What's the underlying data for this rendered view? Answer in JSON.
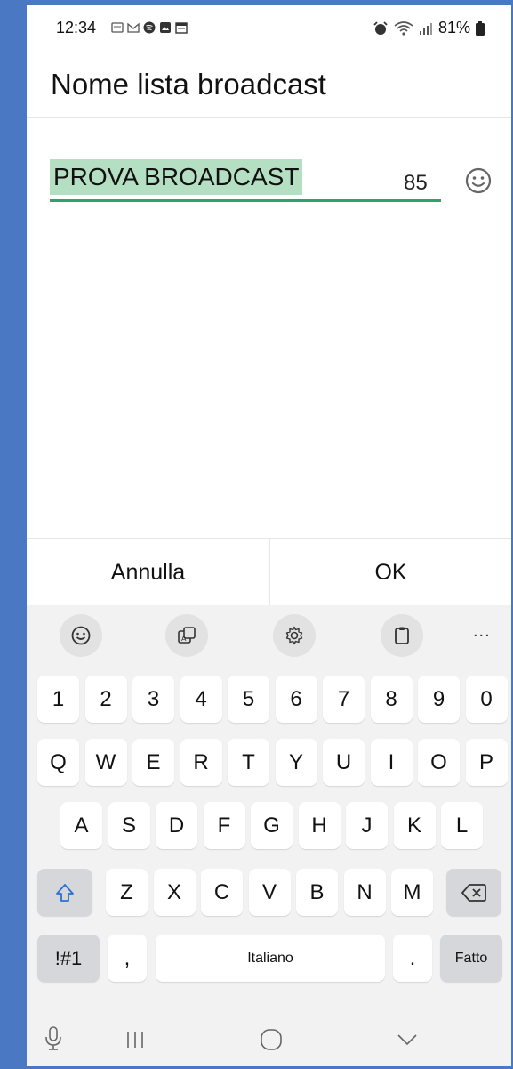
{
  "status_bar": {
    "time": "12:34",
    "battery": "81%"
  },
  "dialog": {
    "title": "Nome lista broadcast",
    "input_value": "PROVA BROADCAST",
    "char_count": "85",
    "cancel_label": "Annulla",
    "ok_label": "OK"
  },
  "keyboard": {
    "toolbar": [
      "emoji-icon",
      "translate-icon",
      "gear-icon",
      "clipboard-icon",
      "more-icon"
    ],
    "more_label": "...",
    "row1": [
      "1",
      "2",
      "3",
      "4",
      "5",
      "6",
      "7",
      "8",
      "9",
      "0"
    ],
    "row2": [
      "Q",
      "W",
      "E",
      "R",
      "T",
      "Y",
      "U",
      "I",
      "O",
      "P"
    ],
    "row3": [
      "A",
      "S",
      "D",
      "F",
      "G",
      "H",
      "J",
      "K",
      "L"
    ],
    "row4": [
      "Z",
      "X",
      "C",
      "V",
      "B",
      "N",
      "M"
    ],
    "symbols_label": "!#1",
    "comma_label": ",",
    "space_label": "Italiano",
    "period_label": ".",
    "done_label": "Fatto"
  },
  "colors": {
    "frame": "#4a78c2",
    "selection": "#b5dfc3",
    "underline": "#2da26b",
    "keyboard_bg": "#f2f2f2"
  }
}
